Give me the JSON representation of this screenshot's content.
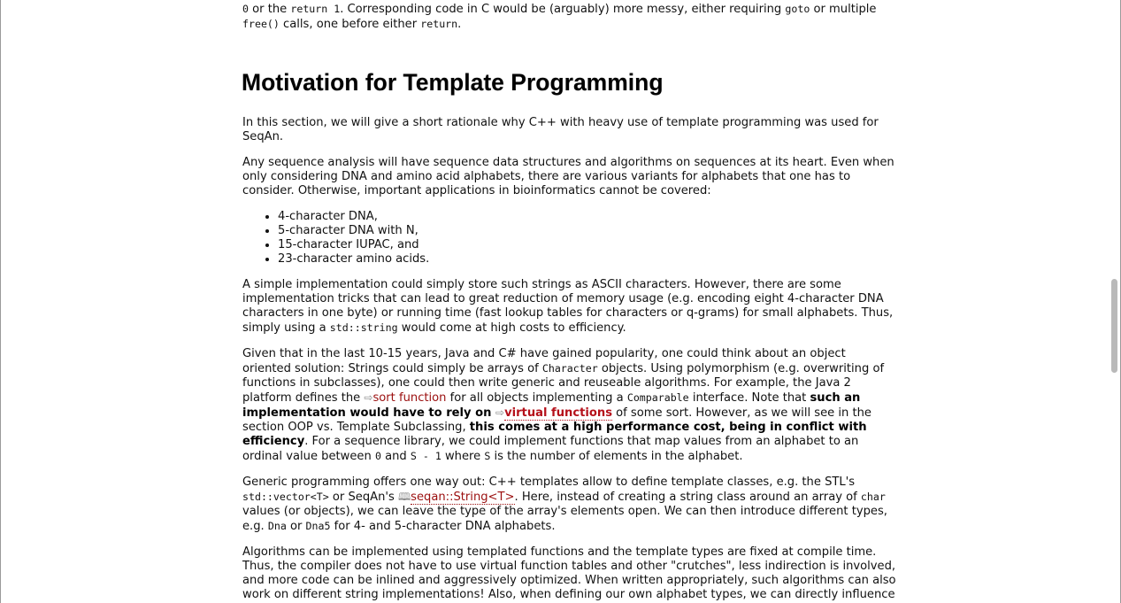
{
  "p0": {
    "s1": "0",
    "s2": " or the ",
    "s3": "return 1",
    "s4": ". Corresponding code in C would be (arguably) more messy, either requiring ",
    "s5": "goto",
    "s6": " or multiple ",
    "s7": "free()",
    "s8": " calls, one before either ",
    "s9": "return",
    "s10": "."
  },
  "heading": "Motivation for Template Programming",
  "p1": "In this section, we will give a short rationale why C++ with heavy use of template programming was used for SeqAn.",
  "p2": "Any sequence analysis will have sequence data structures and algorithms on sequences at its heart. Even when only considering DNA and amino acid alphabets, there are various variants for alphabets that one has to consider. Otherwise, important applications in bioinformatics cannot be covered:",
  "list": [
    "4-character DNA,",
    "5-character DNA with N,",
    "15-character IUPAC, and",
    "23-character amino acids."
  ],
  "p3": {
    "s1": "A simple implementation could simply store such strings as ASCII characters. However, there are some implementation tricks that can lead to great reduction of memory usage (e.g. encoding eight 4-character DNA characters in one byte) or running time (fast lookup tables for characters or q-grams) for small alphabets. Thus, simply using a ",
    "s2": "std::string",
    "s3": " would come at high costs to efficiency."
  },
  "p4": {
    "s1": "Given that in the last 10-15 years, Java and C# have gained popularity, one could think about an object oriented solution: Strings could simply be arrays of ",
    "s2": "Character",
    "s3": " objects. Using polymorphism (e.g. overwriting of functions in subclasses), one could then write generic and reuseable algorithms. For example, the Java 2 platform defines the ",
    "link1": "sort function",
    "s4": " for all objects implementing a ",
    "s5": "Comparable",
    "s6": " interface. Note that ",
    "b1": "such an implementation would have to rely on ",
    "link2": "virtual functions",
    "s7": " of some sort. However, as we will see in the section OOP vs. Template Subclassing, ",
    "b2": "this comes at a high performance cost, being in conflict with efficiency",
    "s8": ". For a sequence library, we could implement functions that map values from an alphabet to an ordinal value between ",
    "s9": "0",
    "s10": " and ",
    "s11": "S - 1",
    "s12": " where ",
    "s13": "S",
    "s14": " is the number of elements in the alphabet."
  },
  "p5": {
    "s1": "Generic programming offers one way out: C++ templates allow to define template classes, e.g. the STL's ",
    "s2": "std::vector<T>",
    "s3": " or SeqAn's ",
    "link": "seqan::String<T>",
    "s4": ". Here, instead of creating a string class around an array of ",
    "s5": "char",
    "s6": " values (or objects), we can leave the type of the array's elements open. We can then introduce different types, e.g. ",
    "s7": "Dna",
    "s8": " or ",
    "s9": "Dna5",
    "s10": " for 4- and 5-character DNA alphabets."
  },
  "p6": "Algorithms can be implemented using templated functions and the template types are fixed at compile time. Thus, the compiler does not have to use virtual function tables and other \"crutches\", less indirection is involved, and more code can be inlined and aggressively optimized. When written appropriately, such algorithms can also work on different string implementations! Also, when defining our own alphabet types, we can directly influence how their abstractions (and APIs) work.",
  "icons": {
    "external_link": "external-link-icon",
    "book": "book-icon"
  }
}
